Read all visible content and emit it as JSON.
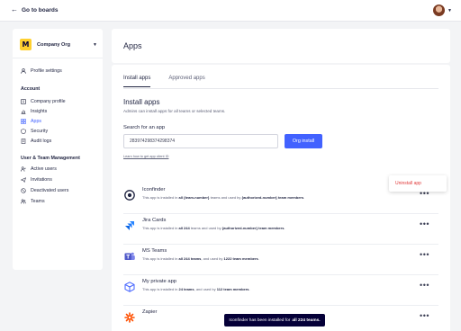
{
  "topbar": {
    "back_label": "Go to boards"
  },
  "sidebar": {
    "org_name": "Company Org",
    "org_logo_letter": "M",
    "profile_settings": "Profile settings",
    "account_title": "Account",
    "account_items": [
      "Company profile",
      "Insights",
      "Apps",
      "Security",
      "Audit logs"
    ],
    "management_title": "User & Team Management",
    "management_items": [
      "Active users",
      "Invitations",
      "Deactivated users",
      "Teams"
    ]
  },
  "main": {
    "title": "Apps",
    "tabs": [
      "Install apps",
      "Approved apps"
    ],
    "install_title": "Install apps",
    "install_desc": "Admins can install apps for all teams or selected teams.",
    "search_label": "Search for an app",
    "search_value": "283974298374298374",
    "install_button": "Org install",
    "help_link": "Learn how to get app client ID"
  },
  "apps": [
    {
      "name": "Iconfinder",
      "pre": "This app is installed in ",
      "b1": "all {team-number}",
      "mid": " teams and used by ",
      "b2": "{authorized-number} team members",
      "post": "."
    },
    {
      "name": "Jira Cards",
      "pre": "This app is installed in ",
      "b1": "all 244",
      "mid": " teams and used by ",
      "b2": "{authorized-number} team members",
      "post": "."
    },
    {
      "name": "MS Teams",
      "pre": "This app is installed in ",
      "b1": "all 244 teams",
      "mid": ", and used by ",
      "b2": "1222 team members",
      "post": "."
    },
    {
      "name": "My private app",
      "pre": "This app is installed in ",
      "b1": "24 teams",
      "mid": ", and used by ",
      "b2": "112 team members",
      "post": "."
    },
    {
      "name": "Zapier",
      "pre": "",
      "b1": "",
      "mid": "",
      "b2": "",
      "post": ""
    }
  ],
  "menu": {
    "uninstall": "Uninstall app"
  },
  "toast": {
    "text": "Iconfinder has been installed for",
    "bold": "all 224 teams."
  },
  "colors": {
    "accent": "#4262ff",
    "danger": "#e03a3a",
    "brand_yellow": "#ffd02f",
    "toast_bg": "#050038"
  }
}
